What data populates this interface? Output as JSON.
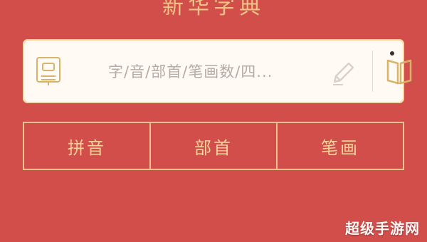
{
  "header": {
    "title": "新华字典"
  },
  "search": {
    "placeholder": "字/音/部首/笔画数/四..."
  },
  "tabs": [
    {
      "label": "拼音"
    },
    {
      "label": "部首"
    },
    {
      "label": "笔画"
    }
  ],
  "watermark": {
    "text": "超级手游网"
  },
  "colors": {
    "background": "#d24e4b",
    "accent": "#f3d08d",
    "card": "#fffaf3"
  },
  "icons": {
    "left": "dictionary-icon",
    "edit": "pencil-icon",
    "book": "book-icon"
  }
}
